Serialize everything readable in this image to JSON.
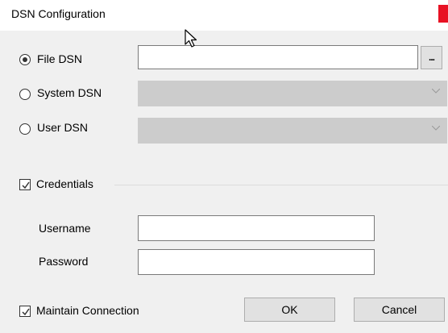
{
  "window": {
    "title": "DSN Configuration"
  },
  "dsn": {
    "file_label": "File DSN",
    "file_selected": true,
    "file_value": "",
    "browse_label": "...",
    "system_label": "System DSN",
    "system_value": "",
    "user_label": "User DSN",
    "user_value": ""
  },
  "credentials": {
    "label": "Credentials",
    "checked": true,
    "username_label": "Username",
    "username_value": "",
    "password_label": "Password",
    "password_value": ""
  },
  "footer": {
    "maintain_label": "Maintain Connection",
    "maintain_checked": true,
    "ok_label": "OK",
    "cancel_label": "Cancel"
  },
  "colors": {
    "close_button": "#e81123",
    "disabled_combo": "#cccccc"
  },
  "icons": {
    "close": "close-icon",
    "cursor": "mouse-pointer-icon",
    "chevron": "chevron-down-icon"
  }
}
